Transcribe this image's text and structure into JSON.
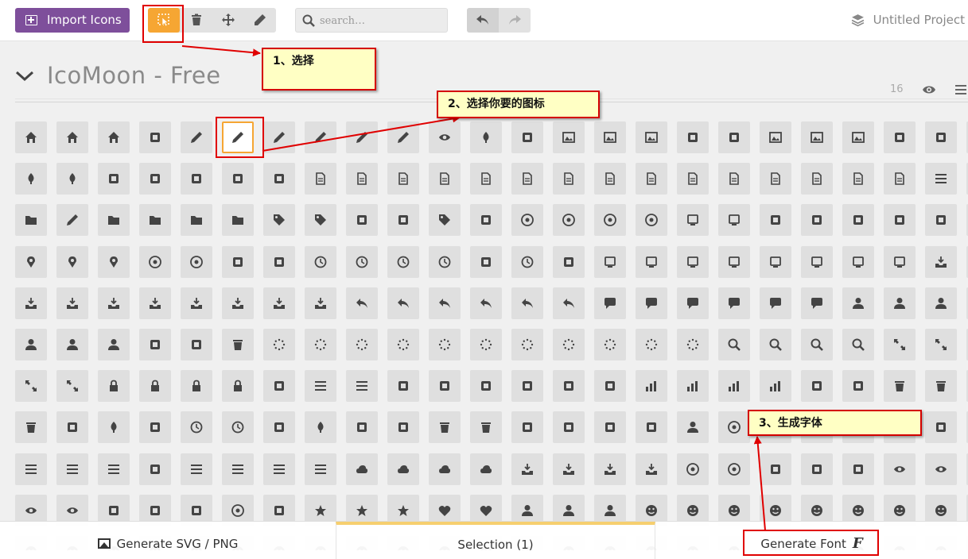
{
  "toolbar": {
    "import_label": "Import Icons",
    "search_placeholder": "search…",
    "project_label": "Untitled Project"
  },
  "iconset": {
    "title": "IcoMoon - Free",
    "count": "16"
  },
  "bottom": {
    "generate_svg": "Generate SVG / PNG",
    "selection": "Selection (1)",
    "generate_font": "Generate Font",
    "font_glyph": "F"
  },
  "annotations": {
    "step1": "1、选择",
    "step2": "2、选择你要的图标",
    "step3": "3、生成字体"
  },
  "colors": {
    "accent": "#f6a633",
    "import_bg": "#7e4f9b",
    "annotation_red": "#e00000",
    "note_bg": "#ffffc4"
  },
  "icons": [
    [
      "home",
      "home2",
      "home3",
      "office",
      "newspaper",
      "pencil",
      "pencil2",
      "quill",
      "pen",
      "blog",
      "eyedropper",
      "droplet",
      "paint-format",
      "image",
      "images",
      "camera",
      "headphones",
      "music",
      "play",
      "film",
      "video-camera",
      "dice",
      "pacman",
      "spades"
    ],
    [
      "clubs",
      "diamonds",
      "bullhorn",
      "connection",
      "podcast",
      "feed",
      "mic",
      "book",
      "books",
      "library",
      "file-text",
      "profile",
      "file-empty",
      "files-empty",
      "file-text2",
      "file-picture",
      "file-music",
      "file-play",
      "file-video",
      "file-zip",
      "copy",
      "paste",
      "stack",
      ""
    ],
    [
      "folder",
      "folder-open",
      "folder-plus",
      "folder-minus",
      "folder-download",
      "folder-upload",
      "price-tag",
      "price-tags",
      "barcode",
      "qrcode",
      "ticket",
      "cart",
      "coin-dollar",
      "coin-euro",
      "coin-pound",
      "coin-yen",
      "credit-card",
      "calculator",
      "lifebuoy",
      "phone",
      "phone-hang-up",
      "address-book",
      "envelop",
      ""
    ],
    [
      "pushpin",
      "location",
      "location2",
      "compass",
      "compass2",
      "map",
      "map2",
      "history",
      "clock",
      "clock2",
      "alarm",
      "bell",
      "stopwatch",
      "calendar",
      "printer",
      "keyboard",
      "display",
      "laptop",
      "mobile",
      "mobile2",
      "tablet",
      "tv",
      "drawer",
      ""
    ],
    [
      "drawer2",
      "box-add",
      "box-remove",
      "download",
      "upload",
      "floppy-disk",
      "drive",
      "database",
      "undo",
      "redo",
      "undo2",
      "redo2",
      "forward",
      "reply",
      "bubble",
      "bubbles",
      "bubbles2",
      "bubble2",
      "bubbles3",
      "bubbles4",
      "user",
      "users",
      "user-plus",
      ""
    ],
    [
      "user-minus",
      "user-check",
      "user-tie",
      "quotes-left",
      "quotes-right",
      "hour-glass",
      "spinner",
      "spinner2",
      "spinner3",
      "spinner4",
      "spinner5",
      "spinner6",
      "spinner7",
      "spinner8",
      "spinner9",
      "spinner10",
      "spinner11",
      "binoculars",
      "search",
      "zoom-in",
      "zoom-out",
      "enlarge",
      "shrink",
      ""
    ],
    [
      "enlarge2",
      "shrink2",
      "key",
      "key2",
      "lock",
      "unlocked",
      "wrench",
      "equalizer",
      "equalizer2",
      "cog",
      "cogs",
      "hammer",
      "magic-wand",
      "aid-kit",
      "bug",
      "pie-chart",
      "stats-dots",
      "stats-bars",
      "stats-bars2",
      "trophy",
      "gift",
      "glass",
      "glass2",
      ""
    ],
    [
      "mug",
      "spoon-knife",
      "leaf",
      "rocket",
      "meter",
      "meter2",
      "hammer2",
      "fire",
      "lab",
      "magnet",
      "bin",
      "bin2",
      "briefcase",
      "airplane",
      "truck",
      "road",
      "accessibility",
      "target",
      "shield",
      "power",
      "switch",
      "power-cord",
      "clipboard",
      ""
    ],
    [
      "list-numbered",
      "list",
      "list2",
      "tree",
      "menu",
      "menu2",
      "menu3",
      "menu4",
      "cloud",
      "cloud-download",
      "cloud-upload",
      "cloud-check",
      "download2",
      "upload2",
      "download3",
      "upload3",
      "sphere",
      "earth",
      "link",
      "flag",
      "attachment",
      "eye",
      "eye-plus",
      ""
    ],
    [
      "eye-minus",
      "eye-blocked",
      "bookmark",
      "bookmarks",
      "sun",
      "contrast",
      "brightness",
      "star-empty",
      "star-half",
      "star-full",
      "heart",
      "heart-broken",
      "man",
      "woman",
      "man-woman",
      "happy",
      "happy2",
      "smile",
      "smile2",
      "tongue",
      "tongue2",
      "sad",
      "sad2",
      ""
    ],
    [
      "wink",
      "wink2",
      "grin",
      "grin2",
      "cool",
      "cool2",
      "angry",
      "angry2",
      "evil",
      "evil2",
      "shocked",
      "shocked2",
      "baffled",
      "baffled2",
      "confused",
      "confused2",
      "neutral",
      "neutral2",
      "hipster",
      "hipster2",
      "wondering",
      "wondering2",
      "sleepy",
      ""
    ]
  ]
}
